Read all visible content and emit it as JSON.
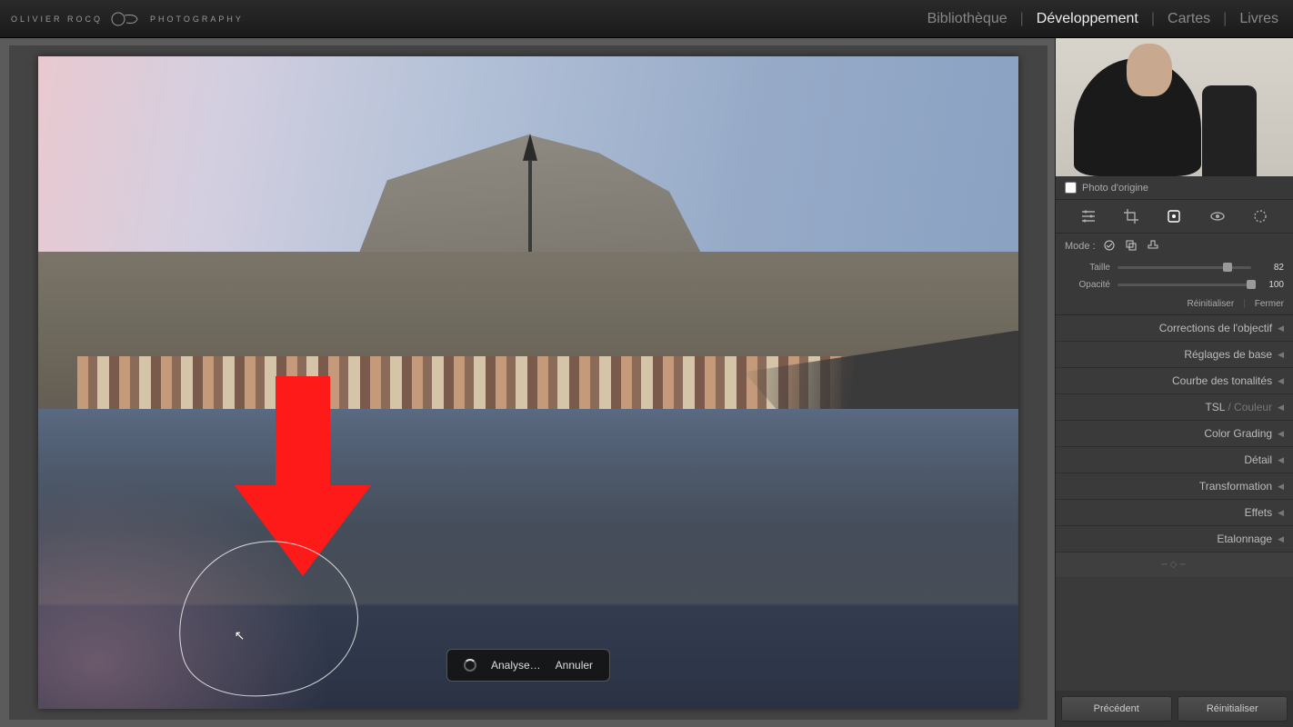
{
  "brand": {
    "left": "OLIVIER ROCQ",
    "right": "PHOTOGRAPHY"
  },
  "nav": {
    "library": "Bibliothèque",
    "develop": "Développement",
    "map": "Cartes",
    "book": "Livres"
  },
  "origin": {
    "label": "Photo d'origine"
  },
  "mode": {
    "label": "Mode :"
  },
  "sliders": {
    "size": {
      "label": "Taille",
      "value": "82",
      "pct": 82
    },
    "opacity": {
      "label": "Opacité",
      "value": "100",
      "pct": 100
    }
  },
  "reset_row": {
    "reset": "Réinitialiser",
    "close": "Fermer"
  },
  "panels": {
    "lens": "Corrections de l'objectif",
    "basic": "Réglages de base",
    "tone": "Courbe des tonalités",
    "tsl": "TSL",
    "color_sep": " / ",
    "color": "Couleur",
    "grading": "Color Grading",
    "detail": "Détail",
    "transform": "Transformation",
    "effects": "Effets",
    "calibration": "Etalonnage"
  },
  "analyze": {
    "status": "Analyse…",
    "cancel": "Annuler"
  },
  "footer": {
    "prev": "Précédent",
    "reset": "Réinitialiser"
  }
}
